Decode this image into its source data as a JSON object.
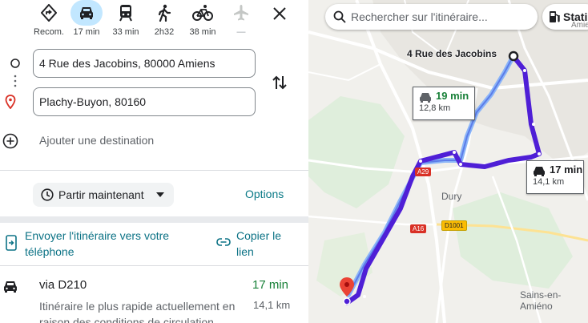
{
  "modes": [
    {
      "name": "mode-recommended",
      "icon": "diamond-turn-icon",
      "label": "Recom.",
      "active": false
    },
    {
      "name": "mode-driving",
      "icon": "car-icon",
      "label": "17 min",
      "active": true
    },
    {
      "name": "mode-transit",
      "icon": "train-icon",
      "label": "33 min",
      "active": false
    },
    {
      "name": "mode-walking",
      "icon": "walk-icon",
      "label": "2h32",
      "active": false
    },
    {
      "name": "mode-cycling",
      "icon": "bike-icon",
      "label": "38 min",
      "active": false
    },
    {
      "name": "mode-flight",
      "icon": "plane-icon",
      "label": "—",
      "active": false
    }
  ],
  "origin": "4 Rue des Jacobins, 80000 Amiens",
  "destination": "Plachy-Buyon, 80160",
  "add_destination": "Ajouter une destination",
  "leave_now": "Partir maintenant",
  "options": "Options",
  "send_to_phone": "Envoyer l'itinéraire vers votre téléphone",
  "copy_link": "Copier le lien",
  "route": {
    "title": "via D210",
    "time": "17 min",
    "distance": "14,1 km",
    "description": "Itinéraire le plus rapide actuellement en raison des conditions de circulation"
  },
  "map": {
    "search_placeholder": "Rechercher sur l'itinéraire...",
    "chip_label": "Stati",
    "origin_label": "4 Rue des Jacobins",
    "alt_route": {
      "time": "19 min",
      "distance": "12,8 km"
    },
    "main_route": {
      "time": "17 min",
      "distance": "14,1 km"
    },
    "places": {
      "dury": "Dury",
      "sains": "Sains-en-Amiéno",
      "amiens_top": "Amiens"
    },
    "roads": {
      "a29": "A29",
      "a16": "A16",
      "d1001": "D1001"
    }
  },
  "colors": {
    "route": "#4f1fd6",
    "alt_route": "#8ab4f8",
    "accent": "#0b7285",
    "time_green": "#188038"
  }
}
